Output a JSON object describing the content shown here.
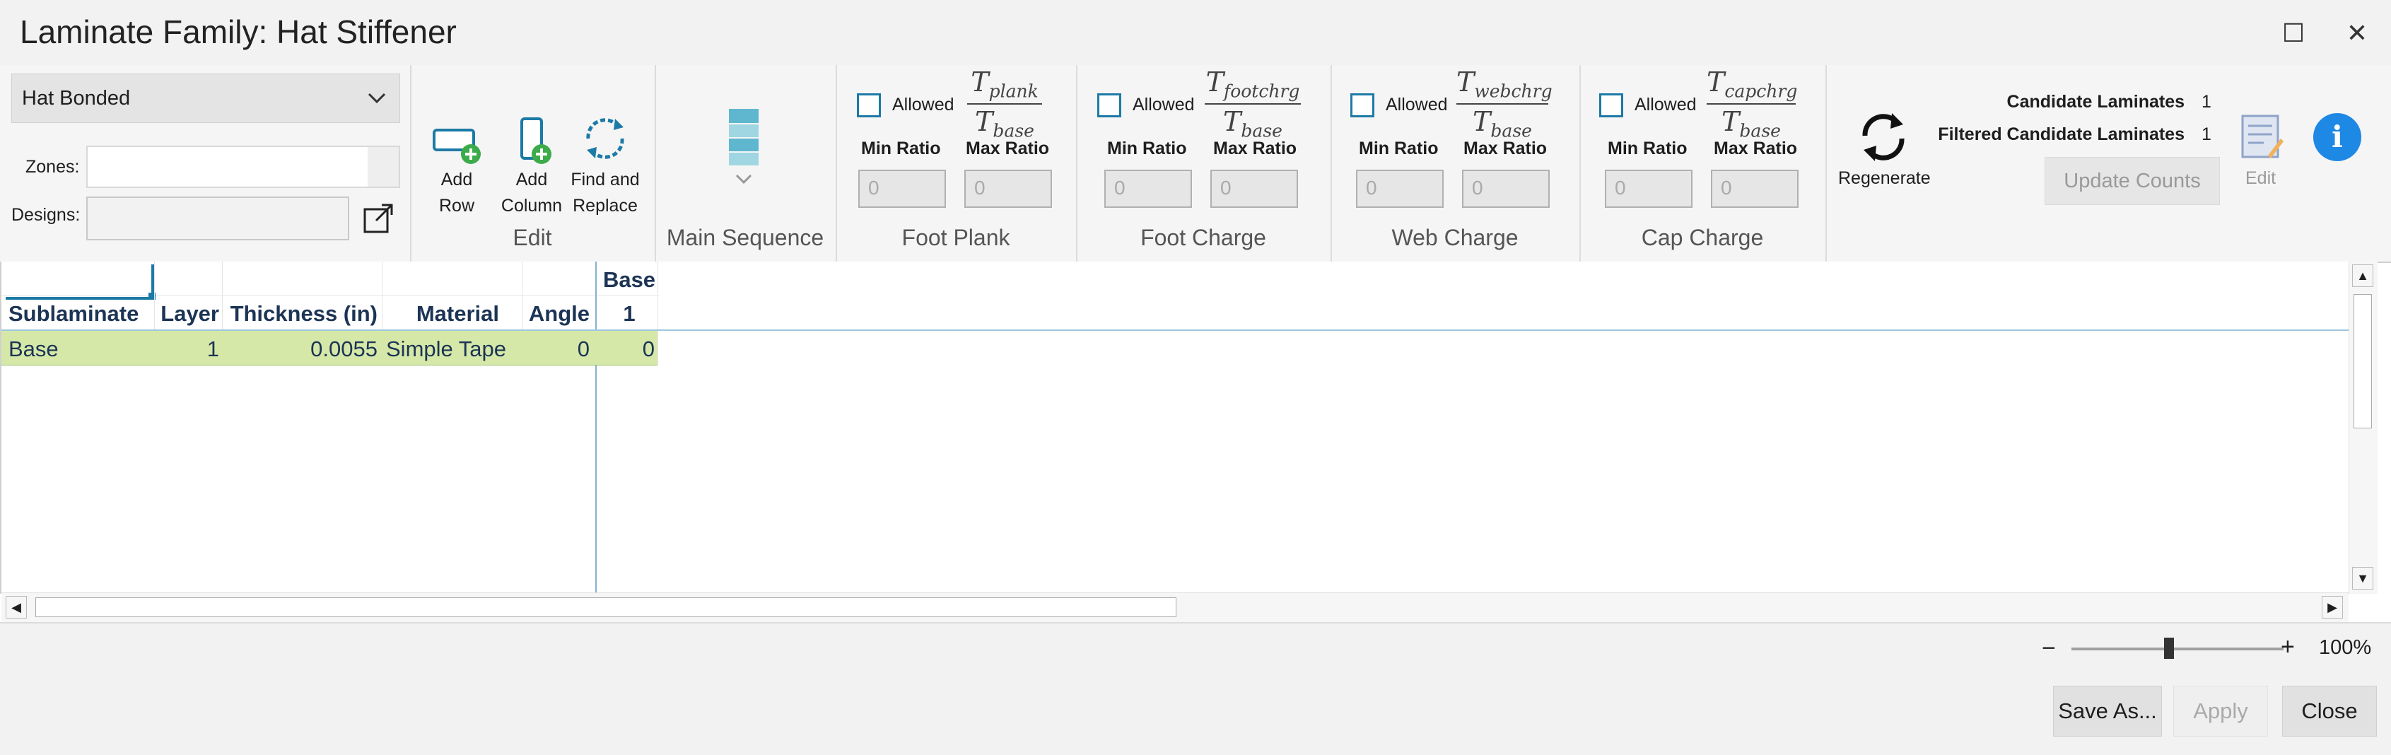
{
  "window": {
    "title": "Laminate Family: Hat Stiffener",
    "maximize_glyph": "☐",
    "close_glyph": "✕"
  },
  "left_panel": {
    "family_type": "Hat Bonded",
    "zones_label": "Zones:",
    "designs_label": "Designs:"
  },
  "edit_group": {
    "label": "Edit",
    "add_row": [
      "Add",
      "Row"
    ],
    "add_column": [
      "Add",
      "Column"
    ],
    "find_replace": [
      "Find and",
      "Replace"
    ]
  },
  "main_sequence": {
    "label": "Main Sequence"
  },
  "ratio_groups": [
    {
      "label": "Foot Plank",
      "allowed": "Allowed",
      "numerator": "T",
      "num_sub": "plank",
      "denominator": "T",
      "den_sub": "base",
      "min_label": "Min Ratio",
      "max_label": "Max Ratio",
      "min_value": "0",
      "max_value": "0"
    },
    {
      "label": "Foot Charge",
      "allowed": "Allowed",
      "numerator": "T",
      "num_sub": "footchrg",
      "denominator": "T",
      "den_sub": "base",
      "min_label": "Min Ratio",
      "max_label": "Max Ratio",
      "min_value": "0",
      "max_value": "0"
    },
    {
      "label": "Web Charge",
      "allowed": "Allowed",
      "numerator": "T",
      "num_sub": "webchrg",
      "denominator": "T",
      "den_sub": "base",
      "min_label": "Min Ratio",
      "max_label": "Max Ratio",
      "min_value": "0",
      "max_value": "0"
    },
    {
      "label": "Cap Charge",
      "allowed": "Allowed",
      "numerator": "T",
      "num_sub": "capchrg",
      "denominator": "T",
      "den_sub": "base",
      "min_label": "Min Ratio",
      "max_label": "Max Ratio",
      "min_value": "0",
      "max_value": "0"
    }
  ],
  "regenerate": {
    "label": "Regenerate"
  },
  "counts": {
    "candidate_label": "Candidate Laminates",
    "candidate_value": "1",
    "filtered_label": "Filtered Candidate Laminates",
    "filtered_value": "1",
    "update_label": "Update Counts",
    "edit_label": "Edit"
  },
  "grid": {
    "top_header": {
      "base": "Base"
    },
    "columns": [
      "Sublaminate",
      "Layer",
      "Thickness (in)",
      "Material",
      "Angle",
      "1"
    ],
    "rows": [
      {
        "sublaminate": "Base",
        "layer": "1",
        "thickness": "0.0055",
        "material": "Simple Tape",
        "angle": "0",
        "value": "0"
      }
    ],
    "row_color": "#d5e8a8"
  },
  "zoom": {
    "minus": "−",
    "plus": "+",
    "value": "100%",
    "level_fraction": 0.46
  },
  "footer": {
    "save_as": "Save As...",
    "apply": "Apply",
    "close": "Close"
  },
  "colors": {
    "accent": "#1c7aa6",
    "info": "#1e88e5",
    "add_green": "#3cab4a"
  }
}
